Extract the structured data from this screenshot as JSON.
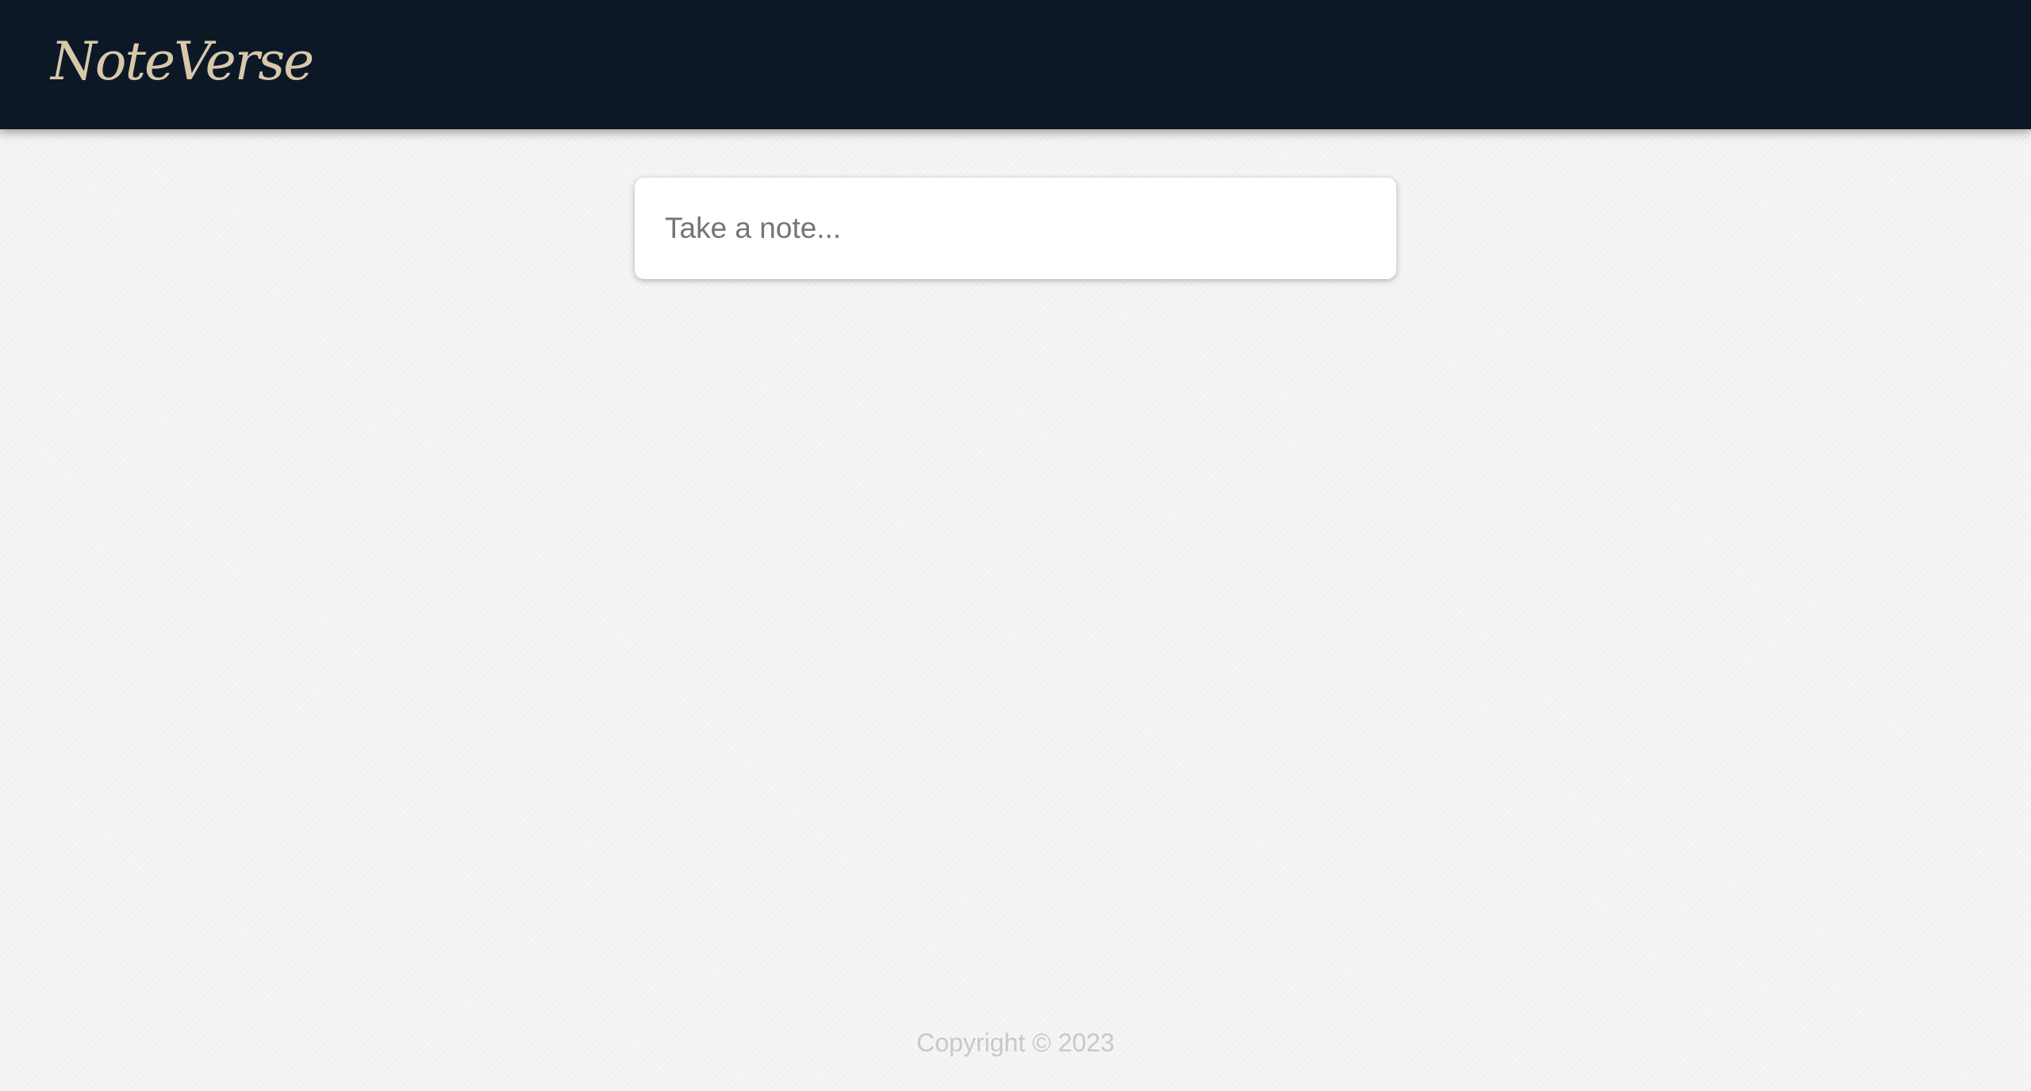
{
  "header": {
    "brand": "NoteVerse"
  },
  "note_form": {
    "placeholder": "Take a note...",
    "value": ""
  },
  "footer": {
    "copyright": "Copyright © 2023"
  },
  "colors": {
    "header_background": "#0d1827",
    "brand_text": "#d8c8aa",
    "page_background": "#f4f4f4",
    "input_background": "#ffffff",
    "placeholder_text": "#757575",
    "footer_text": "#c8c8c8"
  }
}
